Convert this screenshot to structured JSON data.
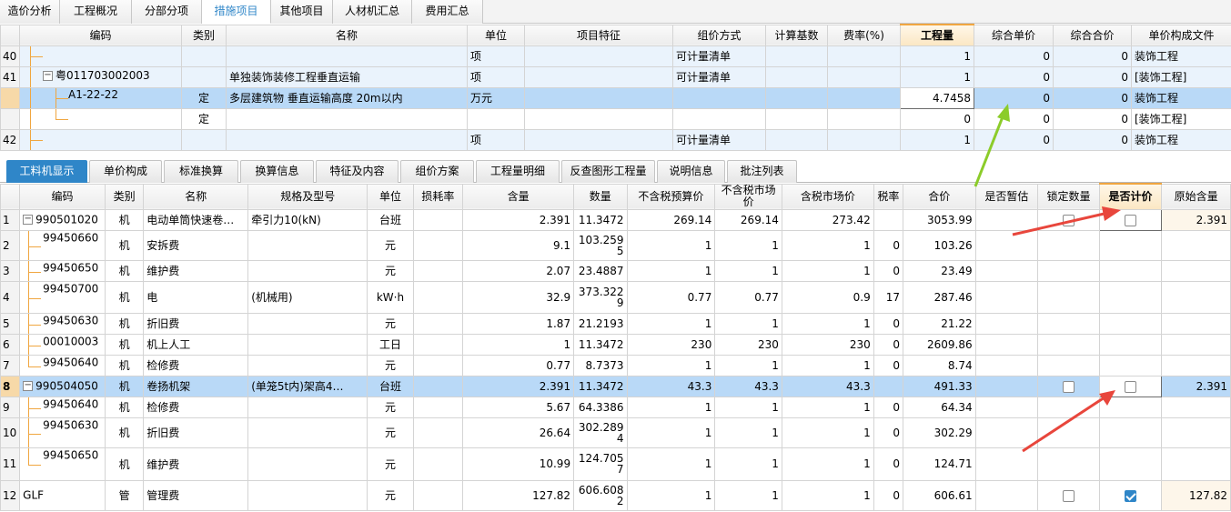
{
  "top_tabs": [
    "造价分析",
    "工程概况",
    "分部分项",
    "措施项目",
    "其他项目",
    "人材机汇总",
    "费用汇总"
  ],
  "top_tab_active": 3,
  "upper": {
    "headers": [
      "",
      "编码",
      "类别",
      "名称",
      "单位",
      "项目特征",
      "组价方式",
      "计算基数",
      "费率(%)",
      "工程量",
      "综合单价",
      "综合合价",
      "单价构成文件"
    ],
    "rows": [
      {
        "rn": "40",
        "code": "",
        "cat": "",
        "name": "",
        "unit": "项",
        "feature": "",
        "method": "可计量清单",
        "base": "",
        "rate": "",
        "qty": "1",
        "uprice": "0",
        "total": "0",
        "file": "装饰工程"
      },
      {
        "rn": "41",
        "code": "粤011703002003",
        "cat": "",
        "name": "单独装饰装修工程垂直运输",
        "unit": "项",
        "feature": "",
        "method": "可计量清单",
        "base": "",
        "rate": "",
        "qty": "1",
        "uprice": "0",
        "total": "0",
        "file": "[装饰工程]"
      },
      {
        "rn": "",
        "code": "A1-22-22",
        "cat": "定",
        "name": "多层建筑物 垂直运输高度 20m以内",
        "unit": "万元",
        "feature": "",
        "method": "",
        "base": "",
        "rate": "",
        "qty": "4.7458",
        "uprice": "0",
        "total": "0",
        "file": "装饰工程"
      },
      {
        "rn": "",
        "code": "",
        "cat": "定",
        "name": "",
        "unit": "",
        "feature": "",
        "method": "",
        "base": "",
        "rate": "",
        "qty": "0",
        "uprice": "0",
        "total": "0",
        "file": "[装饰工程]"
      },
      {
        "rn": "42",
        "code": "",
        "cat": "",
        "name": "",
        "unit": "项",
        "feature": "",
        "method": "可计量清单",
        "base": "",
        "rate": "",
        "qty": "1",
        "uprice": "0",
        "total": "0",
        "file": "装饰工程"
      }
    ]
  },
  "sub_tabs": [
    "工料机显示",
    "单价构成",
    "标准换算",
    "换算信息",
    "特征及内容",
    "组价方案",
    "工程量明细",
    "反查图形工程量",
    "说明信息",
    "批注列表"
  ],
  "sub_tab_active": 0,
  "lower": {
    "headers": [
      "",
      "编码",
      "类别",
      "名称",
      "规格及型号",
      "单位",
      "损耗率",
      "含量",
      "数量",
      "不含税预算价",
      "不含税市场价",
      "含税市场价",
      "税率",
      "合价",
      "是否暂估",
      "锁定数量",
      "是否计价",
      "原始含量"
    ],
    "rows": [
      {
        "rn": "1",
        "code": "990501020",
        "cat": "机",
        "name": "电动单筒快速卷…",
        "spec": "牵引力10(kN)",
        "unit": "台班",
        "loss": "",
        "content": "2.391",
        "qty": "11.3472",
        "p1": "269.14",
        "p2": "269.14",
        "p3": "273.42",
        "tax": "",
        "sum": "3053.99",
        "est": "",
        "lock": "off",
        "priced": "off",
        "orig": "2.391"
      },
      {
        "rn": "2",
        "code": "99450660",
        "cat": "机",
        "name": "安拆费",
        "spec": "",
        "unit": "元",
        "loss": "",
        "content": "9.1",
        "qty": "103.2595",
        "p1": "1",
        "p2": "1",
        "p3": "1",
        "tax": "0",
        "sum": "103.26",
        "est": "",
        "lock": "",
        "priced": "",
        "orig": ""
      },
      {
        "rn": "3",
        "code": "99450650",
        "cat": "机",
        "name": "维护费",
        "spec": "",
        "unit": "元",
        "loss": "",
        "content": "2.07",
        "qty": "23.4887",
        "p1": "1",
        "p2": "1",
        "p3": "1",
        "tax": "0",
        "sum": "23.49",
        "est": "",
        "lock": "",
        "priced": "",
        "orig": ""
      },
      {
        "rn": "4",
        "code": "99450700",
        "cat": "机",
        "name": "电",
        "spec": "(机械用)",
        "unit": "kW·h",
        "loss": "",
        "content": "32.9",
        "qty": "373.3229",
        "p1": "0.77",
        "p2": "0.77",
        "p3": "0.9",
        "tax": "17",
        "sum": "287.46",
        "est": "",
        "lock": "",
        "priced": "",
        "orig": ""
      },
      {
        "rn": "5",
        "code": "99450630",
        "cat": "机",
        "name": "折旧费",
        "spec": "",
        "unit": "元",
        "loss": "",
        "content": "1.87",
        "qty": "21.2193",
        "p1": "1",
        "p2": "1",
        "p3": "1",
        "tax": "0",
        "sum": "21.22",
        "est": "",
        "lock": "",
        "priced": "",
        "orig": ""
      },
      {
        "rn": "6",
        "code": "00010003",
        "cat": "机",
        "name": "机上人工",
        "spec": "",
        "unit": "工日",
        "loss": "",
        "content": "1",
        "qty": "11.3472",
        "p1": "230",
        "p2": "230",
        "p3": "230",
        "tax": "0",
        "sum": "2609.86",
        "est": "",
        "lock": "",
        "priced": "",
        "orig": ""
      },
      {
        "rn": "7",
        "code": "99450640",
        "cat": "机",
        "name": "检修费",
        "spec": "",
        "unit": "元",
        "loss": "",
        "content": "0.77",
        "qty": "8.7373",
        "p1": "1",
        "p2": "1",
        "p3": "1",
        "tax": "0",
        "sum": "8.74",
        "est": "",
        "lock": "",
        "priced": "",
        "orig": ""
      },
      {
        "rn": "8",
        "code": "990504050",
        "cat": "机",
        "name": "卷扬机架",
        "spec": "(单笼5t内)架高4…",
        "unit": "台班",
        "loss": "",
        "content": "2.391",
        "qty": "11.3472",
        "p1": "43.3",
        "p2": "43.3",
        "p3": "43.3",
        "tax": "",
        "sum": "491.33",
        "est": "",
        "lock": "off",
        "priced": "off",
        "orig": "2.391"
      },
      {
        "rn": "9",
        "code": "99450640",
        "cat": "机",
        "name": "检修费",
        "spec": "",
        "unit": "元",
        "loss": "",
        "content": "5.67",
        "qty": "64.3386",
        "p1": "1",
        "p2": "1",
        "p3": "1",
        "tax": "0",
        "sum": "64.34",
        "est": "",
        "lock": "",
        "priced": "",
        "orig": ""
      },
      {
        "rn": "10",
        "code": "99450630",
        "cat": "机",
        "name": "折旧费",
        "spec": "",
        "unit": "元",
        "loss": "",
        "content": "26.64",
        "qty": "302.2894",
        "p1": "1",
        "p2": "1",
        "p3": "1",
        "tax": "0",
        "sum": "302.29",
        "est": "",
        "lock": "",
        "priced": "",
        "orig": ""
      },
      {
        "rn": "11",
        "code": "99450650",
        "cat": "机",
        "name": "维护费",
        "spec": "",
        "unit": "元",
        "loss": "",
        "content": "10.99",
        "qty": "124.7057",
        "p1": "1",
        "p2": "1",
        "p3": "1",
        "tax": "0",
        "sum": "124.71",
        "est": "",
        "lock": "",
        "priced": "",
        "orig": ""
      },
      {
        "rn": "12",
        "code": "GLF",
        "cat": "管",
        "name": "管理费",
        "spec": "",
        "unit": "元",
        "loss": "",
        "content": "127.82",
        "qty": "606.6082",
        "p1": "1",
        "p2": "1",
        "p3": "1",
        "tax": "0",
        "sum": "606.61",
        "est": "",
        "lock": "off",
        "priced": "on",
        "orig": "127.82"
      }
    ]
  },
  "colors": {
    "accent": "#2f86c8",
    "selected_row": "#b9d9f7",
    "highlight_header": "#f0a640",
    "arrow_red": "#e8463c",
    "arrow_green": "#8ccc2a"
  }
}
